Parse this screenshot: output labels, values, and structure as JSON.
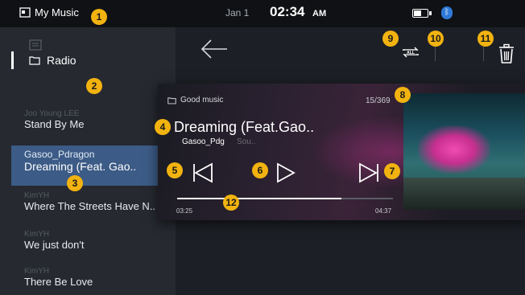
{
  "status_bar": {
    "app_title": "My Music",
    "date": "Jan 1",
    "time": "02:34",
    "ampm": "AM",
    "battery_level": 0.55
  },
  "sidebar": {
    "radio_label": "Radio",
    "tracks": [
      {
        "artist": "Joo Young LEE",
        "title": "Stand By Me"
      },
      {
        "artist": "Gasoo_Pdragon",
        "title": "Dreaming (Feat. Gao.."
      },
      {
        "artist": "KimYH",
        "title": "Where The Streets Have N.."
      },
      {
        "artist": "KimYH",
        "title": "We just don't"
      },
      {
        "artist": "KimYH",
        "title": "There Be Love"
      }
    ]
  },
  "player": {
    "folder": "Good music",
    "track_count": "15/369",
    "title": "Dreaming (Feat.Gao..",
    "artist": "Gasoo_Pdg",
    "album": "Sou..",
    "current_time": "03:25",
    "total_time": "04:37",
    "progress": 0.76
  },
  "badges": [
    "1",
    "2",
    "3",
    "4",
    "5",
    "6",
    "7",
    "8",
    "9",
    "10",
    "11",
    "12"
  ],
  "icons": {
    "app": "music-folder-icon",
    "back": "back-arrow-icon",
    "repeat": "repeat-all-icon",
    "delete": "trash-icon",
    "prev": "previous-track-icon",
    "play": "play-icon",
    "next": "next-track-icon"
  },
  "colors": {
    "accent_badge": "#f2b310",
    "selected_row": "#3c5b86"
  }
}
